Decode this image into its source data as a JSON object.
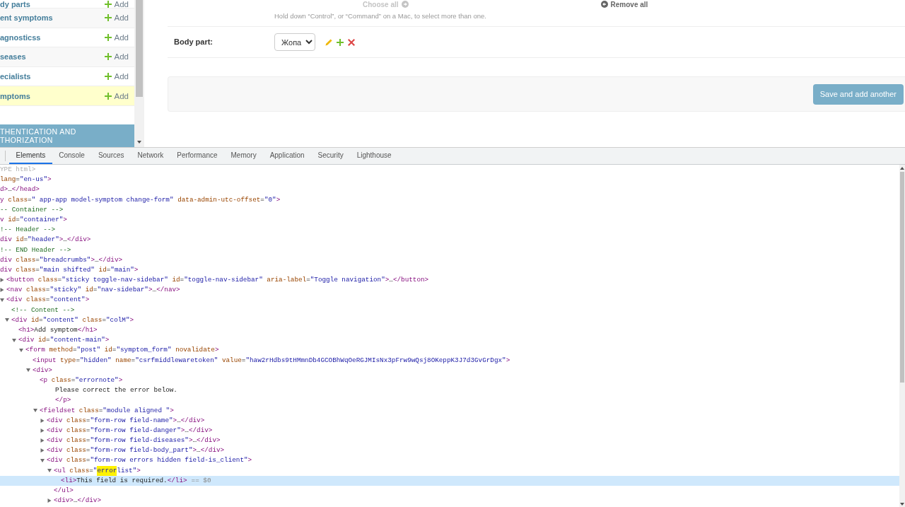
{
  "sidebar": {
    "models": [
      {
        "name": "dy parts",
        "add": "Add",
        "selected": false
      },
      {
        "name": "ent symptoms",
        "add": "Add",
        "selected": false
      },
      {
        "name": "agnosticss",
        "add": "Add",
        "selected": false
      },
      {
        "name": "seases",
        "add": "Add",
        "selected": false
      },
      {
        "name": "ecialists",
        "add": "Add",
        "selected": false
      },
      {
        "name": "mptoms",
        "add": "Add",
        "selected": true
      }
    ],
    "section": "THENTICATION AND THORIZATION"
  },
  "form": {
    "selector_links": [
      {
        "kind": "choose",
        "label": "Choose all",
        "disabled": true
      },
      {
        "kind": "remove",
        "label": "Remove all",
        "disabled": false
      }
    ],
    "help": "Hold down “Control”, or “Command” on a Mac, to select more than one.",
    "fields": [
      {
        "label": "Body part:",
        "value": "Жопа"
      }
    ],
    "buttons": [
      "Save and add another"
    ]
  },
  "devtools": {
    "tabs": [
      {
        "label": "Elements",
        "selected": true
      },
      {
        "label": "Console",
        "selected": false
      },
      {
        "label": "Sources",
        "selected": false
      },
      {
        "label": "Network",
        "selected": false
      },
      {
        "label": "Performance",
        "selected": false
      },
      {
        "label": "Memory",
        "selected": false
      },
      {
        "label": "Application",
        "selected": false
      },
      {
        "label": "Security",
        "selected": false
      },
      {
        "label": "Lighthouse",
        "selected": false
      }
    ],
    "dom": [
      {
        "kind": "doctype",
        "text": "YPE html>",
        "selected": false
      },
      {
        "kind": "element",
        "text": "lang=\"en-us\">",
        "selected": false,
        "children": [
          {
            "kind": "element",
            "text": "d>…</head>",
            "selected": false
          },
          {
            "kind": "element",
            "text": "y class=\" app-app model-symptom change-form\" data-admin-utc-offset=\"0\">",
            "selected": false,
            "children": [
              {
                "kind": "comment",
                "text": "-- Container -->",
                "selected": false
              },
              {
                "kind": "element",
                "text": "v id=\"container\">",
                "selected": false,
                "children": [
                  {
                    "kind": "comment",
                    "text": "!-- Header -->",
                    "selected": false
                  },
                  {
                    "kind": "element",
                    "text": "div id=\"header\">…</div>",
                    "selected": false
                  },
                  {
                    "kind": "comment",
                    "text": "!-- END Header -->",
                    "selected": false
                  },
                  {
                    "kind": "element",
                    "text": "div class=\"breadcrumbs\">…</div>",
                    "selected": false
                  },
                  {
                    "kind": "element",
                    "text": "div class=\"main shifted\" id=\"main\">",
                    "selected": false,
                    "children": [
                      {
                        "kind": "element",
                        "text": "<button class=\"sticky toggle-nav-sidebar\" id=\"toggle-nav-sidebar\" aria-label=\"Toggle navigation\">…</button>",
                        "selected": false,
                        "expanded": false
                      },
                      {
                        "kind": "element",
                        "text": "<nav class=\"sticky\" id=\"nav-sidebar\">…</nav>",
                        "selected": false,
                        "expanded": false
                      },
                      {
                        "kind": "element",
                        "text": "<div class=\"content\">",
                        "selected": false,
                        "expanded": true,
                        "children": [
                          {
                            "kind": "comment",
                            "text": "<!-- Content -->",
                            "selected": false
                          },
                          {
                            "kind": "element",
                            "text": "<div id=\"content\" class=\"colM\">",
                            "selected": false,
                            "expanded": true,
                            "children": [
                              {
                                "kind": "element",
                                "text": "<h1>Add symptom</h1>",
                                "selected": false
                              },
                              {
                                "kind": "element",
                                "text": "<div id=\"content-main\">",
                                "selected": false,
                                "expanded": true,
                                "children": [
                                  {
                                    "kind": "element",
                                    "text": "<form method=\"post\" id=\"symptom_form\" novalidate>",
                                    "selected": false,
                                    "expanded": true,
                                    "children": [
                                      {
                                        "kind": "element",
                                        "text": "<input type=\"hidden\" name=\"csrfmiddlewaretoken\" value=\"haw2rHdbs9tHMmnDb4GCOBhWqOeRGJMIsNx3pFrw9wQsj8OKeppK3J7d3GvGrDgx\">",
                                        "selected": false
                                      },
                                      {
                                        "kind": "element",
                                        "text": "<div>",
                                        "selected": false,
                                        "expanded": true,
                                        "children": [
                                          {
                                            "kind": "element",
                                            "text": "<p class=\"errornote\">",
                                            "selected": false,
                                            "children": [
                                              {
                                                "kind": "text",
                                                "text": "Please correct the error below.",
                                                "selected": false
                                              }
                                            ],
                                            "close": "</p>"
                                          },
                                          {
                                            "kind": "element",
                                            "text": "<fieldset class=\"module aligned \">",
                                            "selected": false,
                                            "expanded": true,
                                            "children": [
                                              {
                                                "kind": "element",
                                                "text": "<div class=\"form-row field-name\">…</div>",
                                                "selected": false,
                                                "expanded": false
                                              },
                                              {
                                                "kind": "element",
                                                "text": "<div class=\"form-row field-danger\">…</div>",
                                                "selected": false,
                                                "expanded": false
                                              },
                                              {
                                                "kind": "element",
                                                "text": "<div class=\"form-row field-diseases\">…</div>",
                                                "selected": false,
                                                "expanded": false
                                              },
                                              {
                                                "kind": "element",
                                                "text": "<div class=\"form-row field-body_part\">…</div>",
                                                "selected": false,
                                                "expanded": false
                                              },
                                              {
                                                "kind": "element",
                                                "text": "<div class=\"form-row errors hidden field-is_client\">",
                                                "selected": false,
                                                "expanded": true,
                                                "children": [
                                                  {
                                                    "kind": "element",
                                                    "parts": [
                                                      {
                                                        "text": "<ul class=\"",
                                                        "highlighted": false
                                                      },
                                                      {
                                                        "text": "error",
                                                        "highlighted": true
                                                      },
                                                      {
                                                        "text": "list\">",
                                                        "highlighted": false
                                                      }
                                                    ],
                                                    "selected": false,
                                                    "expanded": true,
                                                    "children": [
                                                      {
                                                        "kind": "element",
                                                        "text": "<li>This field is required.</li>",
                                                        "selected": true,
                                                        "suffix": "== $0"
                                                      }
                                                    ],
                                                    "close": "</ul>"
                                                  },
                                                  {
                                                    "kind": "element",
                                                    "text": "<div>…</div>",
                                                    "selected": false,
                                                    "expanded": false
                                                  }
                                                ]
                                              }
                                            ]
                                          }
                                        ]
                                      }
                                    ]
                                  }
                                ]
                              }
                            ]
                          }
                        ]
                      }
                    ]
                  }
                ]
              }
            ]
          }
        ]
      }
    ]
  }
}
